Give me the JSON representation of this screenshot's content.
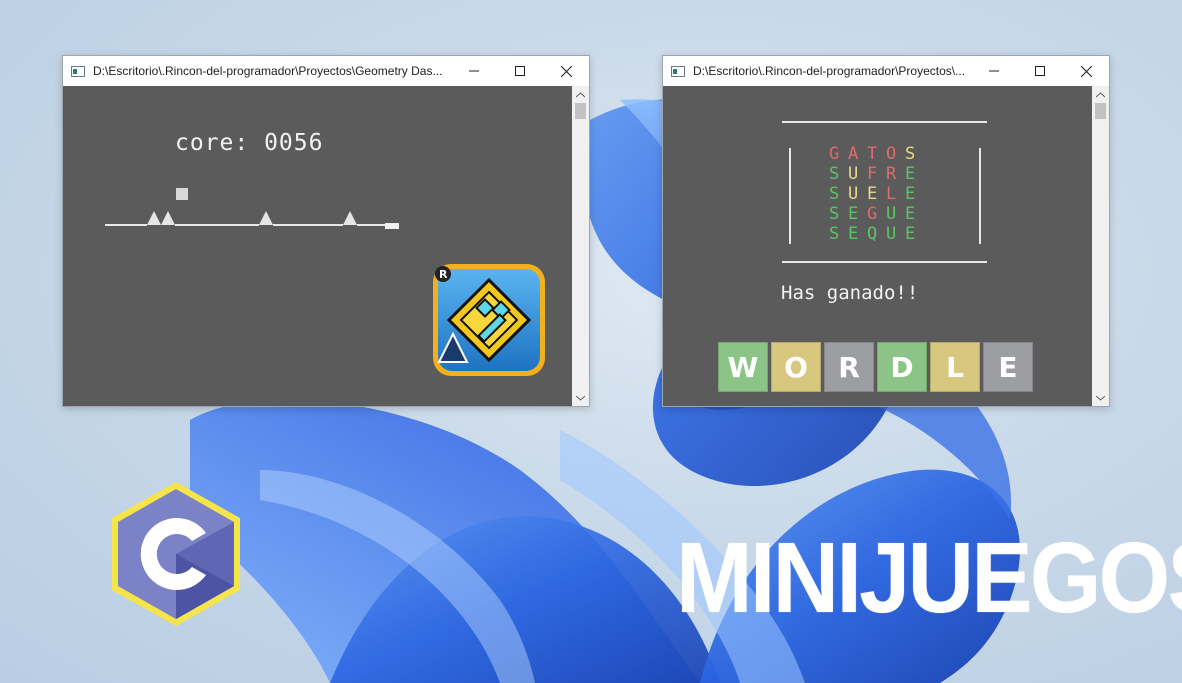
{
  "left_window": {
    "title": "D:\\Escritorio\\.Rincon-del-programador\\Proyectos\\Geometry Das...",
    "score_text": "core: 0056",
    "game_icon": "geometry-dash-cube-icon"
  },
  "right_window": {
    "title": "D:\\Escritorio\\.Rincon-del-programador\\Proyectos\\...",
    "grid": [
      [
        {
          "c": "G",
          "color": "#e06c6c"
        },
        {
          "c": "A",
          "color": "#e06c6c"
        },
        {
          "c": "T",
          "color": "#e06c6c"
        },
        {
          "c": "O",
          "color": "#e06c6c"
        },
        {
          "c": "S",
          "color": "#e8d88a"
        }
      ],
      [
        {
          "c": "S",
          "color": "#5cc463"
        },
        {
          "c": "U",
          "color": "#e8d88a"
        },
        {
          "c": "F",
          "color": "#e06c6c"
        },
        {
          "c": "R",
          "color": "#e06c6c"
        },
        {
          "c": "E",
          "color": "#5cc463"
        }
      ],
      [
        {
          "c": "S",
          "color": "#5cc463"
        },
        {
          "c": "U",
          "color": "#e8d88a"
        },
        {
          "c": "E",
          "color": "#e8d88a"
        },
        {
          "c": "L",
          "color": "#e06c6c"
        },
        {
          "c": "E",
          "color": "#5cc463"
        }
      ],
      [
        {
          "c": "S",
          "color": "#5cc463"
        },
        {
          "c": "E",
          "color": "#5cc463"
        },
        {
          "c": "G",
          "color": "#e06c6c"
        },
        {
          "c": "U",
          "color": "#5cc463"
        },
        {
          "c": "E",
          "color": "#5cc463"
        }
      ],
      [
        {
          "c": "S",
          "color": "#5cc463"
        },
        {
          "c": "E",
          "color": "#5cc463"
        },
        {
          "c": "Q",
          "color": "#5cc463"
        },
        {
          "c": "U",
          "color": "#5cc463"
        },
        {
          "c": "E",
          "color": "#5cc463"
        }
      ]
    ],
    "result_text": "Has ganado!!",
    "logo_tiles": [
      {
        "letter": "W",
        "color": "#8cc487"
      },
      {
        "letter": "O",
        "color": "#d7c77f"
      },
      {
        "letter": "R",
        "color": "#9c9ea2"
      },
      {
        "letter": "D",
        "color": "#8cc487"
      },
      {
        "letter": "L",
        "color": "#d7c77f"
      },
      {
        "letter": "E",
        "color": "#9c9ea2"
      }
    ]
  },
  "c_logo_icon": "c-language-logo-icon",
  "headline": "MINIJUEGOS",
  "colors": {
    "console_bg": "#5b5b5b",
    "c_logo_hex": "#7b82c6",
    "c_logo_border": "#f5e44a"
  }
}
